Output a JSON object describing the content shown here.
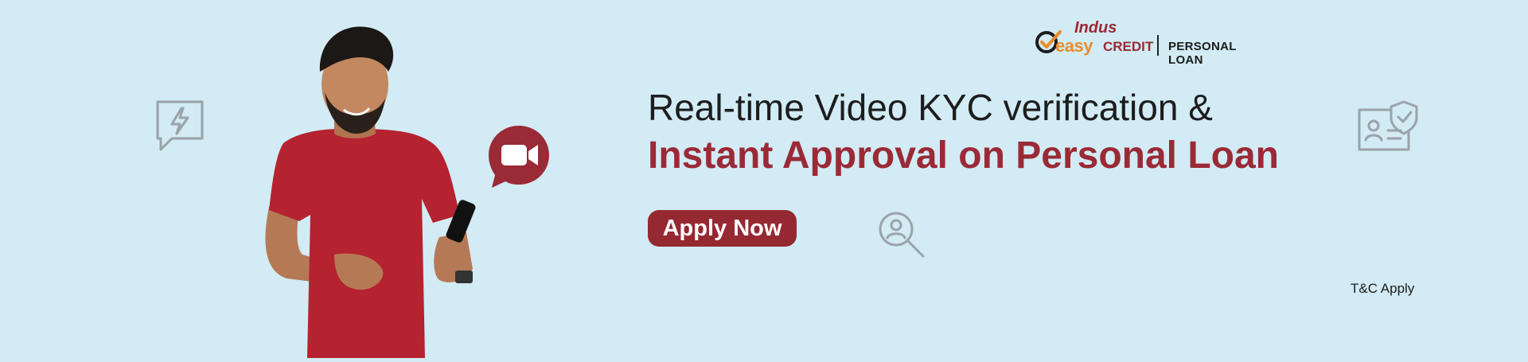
{
  "brand": {
    "indus": "Indus",
    "easy": "easy",
    "credit": "CREDIT",
    "product": "PERSONAL LOAN"
  },
  "headline": {
    "line1": "Real-time Video KYC verification &",
    "line2": "Instant Approval on Personal Loan"
  },
  "cta": {
    "label": "Apply Now"
  },
  "disclaimer": "T&C Apply",
  "colors": {
    "background": "#d2ebf4",
    "brand_red": "#9a2a36",
    "brand_orange": "#e88c2c",
    "text_dark": "#1d1d1d",
    "icon_gray": "#9aa3a8"
  },
  "icons": [
    "lightning-chat-icon",
    "user-search-icon",
    "id-card-shield-icon",
    "video-camera-icon",
    "checkmark-logo-icon"
  ]
}
